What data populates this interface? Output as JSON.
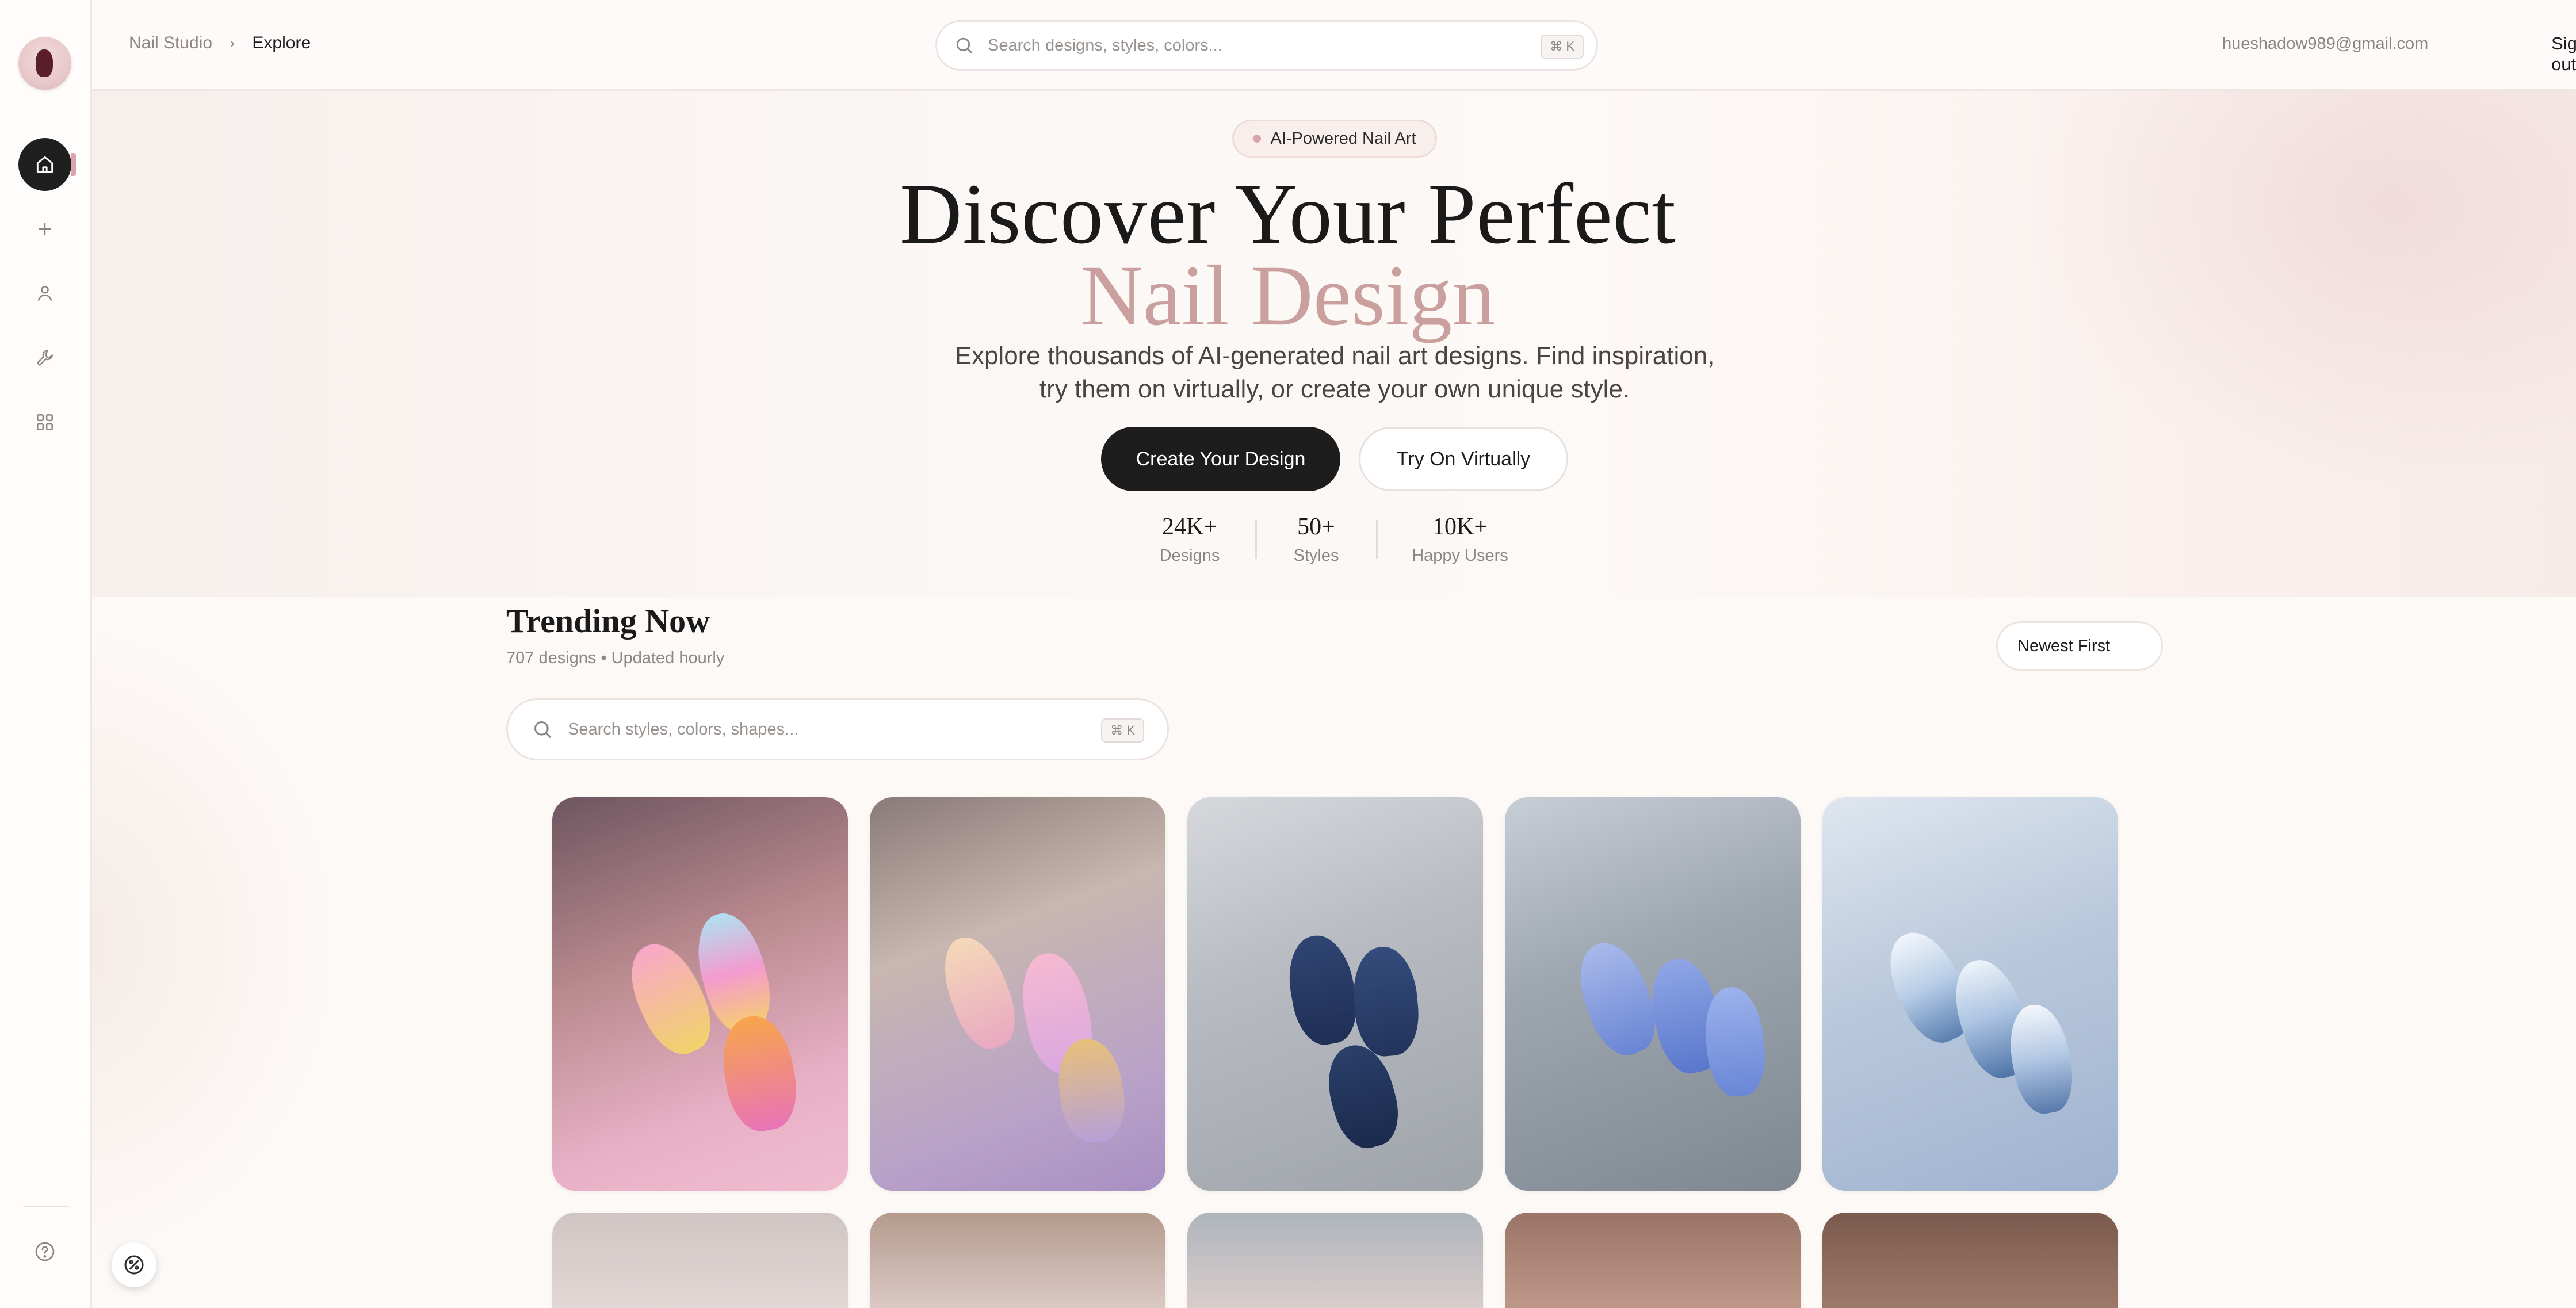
{
  "topbar": {
    "breadcrumb_root": "Nail Studio",
    "breadcrumb_separator": "›",
    "breadcrumb_current": "Explore",
    "search_placeholder": "Search designs, styles, colors...",
    "search_shortcut": "⌘ K",
    "user_email": "hueshadow989@gmail.com",
    "signout_label": "Sign out"
  },
  "sidebar": {
    "items": [
      {
        "icon": "home-icon",
        "active": true
      },
      {
        "icon": "plus-icon",
        "active": false
      },
      {
        "icon": "user-icon",
        "active": false
      },
      {
        "icon": "wrench-icon",
        "active": false
      },
      {
        "icon": "grid-icon",
        "active": false
      }
    ],
    "help_icon": "help-icon"
  },
  "hero": {
    "badge": "AI-Powered Nail Art",
    "title_line1": "Discover Your Perfect",
    "title_line2": "Nail Design",
    "subtitle": "Explore thousands of AI-generated nail art designs. Find inspiration, try them on virtually, or create your own unique style.",
    "primary_button": "Create Your Design",
    "secondary_button": "Try On Virtually",
    "stats": [
      {
        "value": "24K+",
        "label": "Designs"
      },
      {
        "value": "50+",
        "label": "Styles"
      },
      {
        "value": "10K+",
        "label": "Happy Users"
      }
    ]
  },
  "trending": {
    "title": "Trending Now",
    "subtitle": "707 designs • Updated hourly",
    "sort_label": "Newest First",
    "search_placeholder": "Search styles, colors, shapes...",
    "search_shortcut": "⌘ K"
  },
  "colors": {
    "accent": "#1d1d1d",
    "brand_pink": "#c9a09e",
    "background": "#fdf9f7"
  }
}
